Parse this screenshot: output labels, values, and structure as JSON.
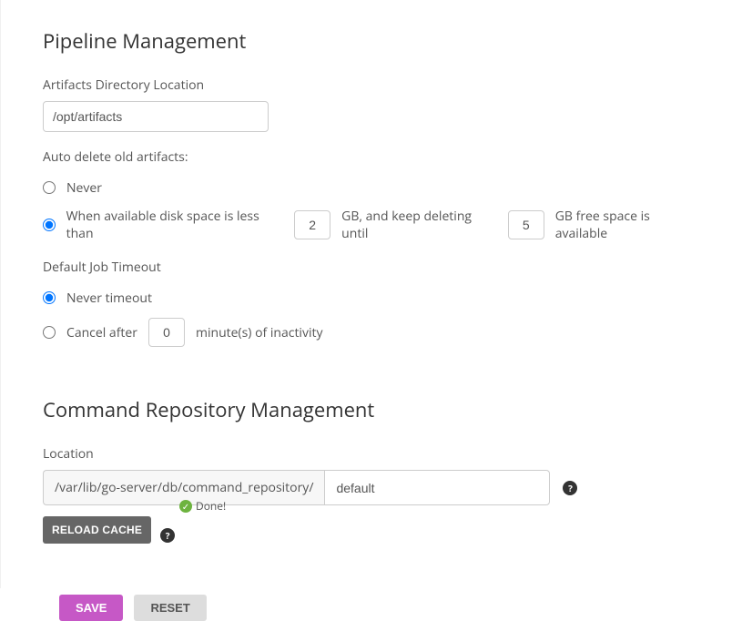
{
  "pipeline": {
    "heading": "Pipeline Management",
    "artifactsDirLabel": "Artifacts Directory Location",
    "artifactsDirValue": "/opt/artifacts",
    "autoDeleteLabel": "Auto delete old artifacts:",
    "neverLabel": "Never",
    "whenPrefix": "When available disk space is less than",
    "whenThreshold": "2",
    "gbAndKeep": "GB, and keep deleting until",
    "whenTarget": "5",
    "gbFree": "GB free space is available",
    "defaultJobTimeoutLabel": "Default Job Timeout",
    "neverTimeoutLabel": "Never timeout",
    "cancelAfterLabel": "Cancel after",
    "cancelMinutes": "0",
    "minutesSuffix": "minute(s) of inactivity"
  },
  "repo": {
    "heading": "Command Repository Management",
    "locationLabel": "Location",
    "prefixPath": "/var/lib/go-server/db/command_repository/",
    "locationValue": "default",
    "reloadLabel": "RELOAD CACHE",
    "doneLabel": "Done!"
  },
  "actions": {
    "save": "SAVE",
    "reset": "RESET"
  }
}
